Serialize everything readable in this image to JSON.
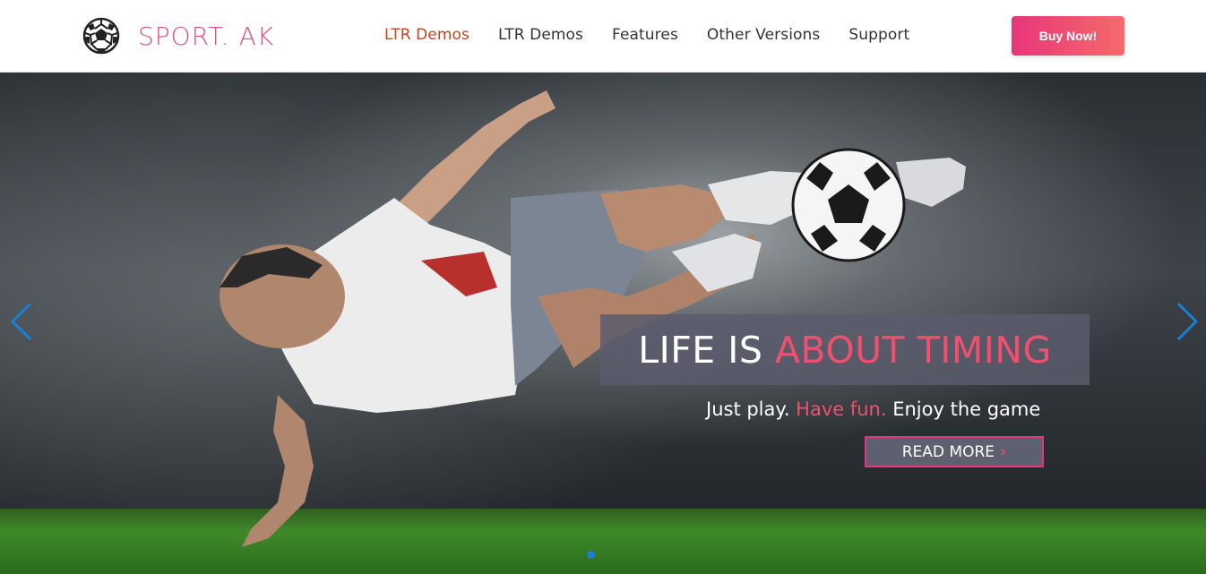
{
  "header": {
    "brand": "SPORT. AK",
    "nav": [
      {
        "label": "LTR Demos",
        "active": true
      },
      {
        "label": "LTR Demos",
        "active": false
      },
      {
        "label": "Features",
        "active": false
      },
      {
        "label": "Other Versions",
        "active": false
      },
      {
        "label": "Support",
        "active": false
      }
    ],
    "buy_label": "Buy Now!"
  },
  "hero": {
    "headline_part1": "LIFE IS ",
    "headline_part2": "ABOUT TIMING",
    "tagline_part1": "Just play. ",
    "tagline_part2": "Have fun.",
    "tagline_part3": " Enjoy the game",
    "read_more_label": "READ MORE",
    "read_more_icon": "chevron-right-icon",
    "prev_icon": "chevron-left-icon",
    "next_icon": "chevron-right-icon"
  },
  "colors": {
    "brand": "#e0507a",
    "nav_active": "#c0441f",
    "accent": "#f0506e",
    "button_gradient_start": "#e8367a",
    "button_gradient_end": "#f56a6a",
    "arrow": "#1a7fd6"
  }
}
